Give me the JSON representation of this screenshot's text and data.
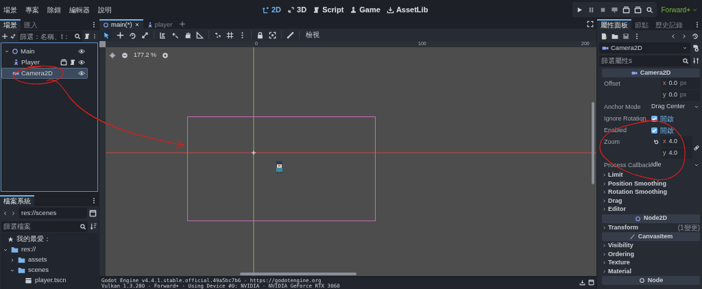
{
  "menu": [
    "場景",
    "專案",
    "除錯",
    "編輯器",
    "說明"
  ],
  "workspaces": [
    {
      "label": "2D",
      "kind": "flat",
      "selected": true
    },
    {
      "label": "3D",
      "kind": "spatial",
      "selected": false
    },
    {
      "label": "Script",
      "kind": "script",
      "selected": false
    },
    {
      "label": "Game",
      "kind": "game",
      "selected": false
    },
    {
      "label": "AssetLib",
      "kind": "library",
      "selected": false
    }
  ],
  "renderer": "Forward+",
  "scene_dock": {
    "tabs": [
      {
        "label": "場景",
        "selected": true
      },
      {
        "label": "匯入",
        "selected": false
      }
    ],
    "filter_placeholder": "篩選：名稱、t：",
    "tree": [
      {
        "name": "Main",
        "kind": "node2d",
        "expanded": true,
        "selected": false,
        "visible": true,
        "children": [
          {
            "name": "Player",
            "kind": "player",
            "selected": false,
            "visible": true,
            "instanced": true,
            "has_script": true
          },
          {
            "name": "Camera2D",
            "kind": "camera",
            "selected": true,
            "visible": true
          }
        ]
      }
    ]
  },
  "filesystem": {
    "tabs": [
      {
        "label": "檔案系統",
        "selected": true
      }
    ],
    "path": "res://scenes",
    "filter_placeholder": "篩選檔案",
    "favorites": "我的最愛：",
    "tree": [
      {
        "name": "res://",
        "kind": "folder",
        "expanded": true,
        "children": [
          {
            "name": "assets",
            "kind": "folder",
            "expanded": false
          },
          {
            "name": "scenes",
            "kind": "folder",
            "expanded": true,
            "children": [
              {
                "name": "player.tscn",
                "kind": "scene"
              }
            ]
          }
        ]
      }
    ]
  },
  "editor_tabs": [
    {
      "label": "main(*)",
      "kind": "node2d",
      "selected": true
    },
    {
      "label": "player",
      "kind": "player",
      "selected": false
    }
  ],
  "view_menu": "檢視",
  "zoom_reading": "177.2 %",
  "ruler_labels": [
    "0",
    "100",
    "200"
  ],
  "output": [
    "Godot Engine v4.4.1.stable.official.49a5bc7b6 - https://godotengine.org",
    "Vulkan 1.3.280 - Forward+ - Using Device #0: NVIDIA - NVIDIA GeForce RTX 3060"
  ],
  "inspector": {
    "tabs": [
      {
        "label": "屬性面板",
        "selected": true
      },
      {
        "label": "節點",
        "selected": false
      },
      {
        "label": "歷史記錄",
        "selected": false
      }
    ],
    "object": "Camera2D",
    "filter_placeholder": "篩選屬性s",
    "items": [
      {
        "kind": "header",
        "label": "Camera2D"
      },
      {
        "kind": "vector",
        "label": "Offset",
        "components": [
          {
            "axis": "x",
            "value": "0.0",
            "unit": "px"
          },
          {
            "axis": "y",
            "value": "0.0",
            "unit": "px"
          }
        ]
      },
      {
        "kind": "enum",
        "label": "Anchor Mode",
        "value": "Drag Center"
      },
      {
        "kind": "check",
        "label": "Ignore Rotation",
        "checked": true,
        "value": "開啟"
      },
      {
        "kind": "check",
        "label": "Enabled",
        "checked": true,
        "value": "開啟"
      },
      {
        "kind": "vector",
        "label": "Zoom",
        "revertable": true,
        "linked": true,
        "components": [
          {
            "axis": "x",
            "value": "4.0"
          },
          {
            "axis": "y",
            "value": "4.0"
          }
        ]
      },
      {
        "kind": "enum",
        "label": "Process Callback",
        "value": "Idle"
      },
      {
        "kind": "group",
        "label": "Limit"
      },
      {
        "kind": "group",
        "label": "Position Smoothing"
      },
      {
        "kind": "group",
        "label": "Rotation Smoothing"
      },
      {
        "kind": "group",
        "label": "Drag"
      },
      {
        "kind": "group",
        "label": "Editor"
      },
      {
        "kind": "header",
        "label": "Node2D"
      },
      {
        "kind": "group",
        "label": "Transform",
        "note": "(1變更)"
      },
      {
        "kind": "header",
        "label": "CanvasItem"
      },
      {
        "kind": "group",
        "label": "Visibility"
      },
      {
        "kind": "group",
        "label": "Ordering"
      },
      {
        "kind": "group",
        "label": "Texture"
      },
      {
        "kind": "group",
        "label": "Material"
      },
      {
        "kind": "header",
        "label": "Node"
      }
    ]
  }
}
